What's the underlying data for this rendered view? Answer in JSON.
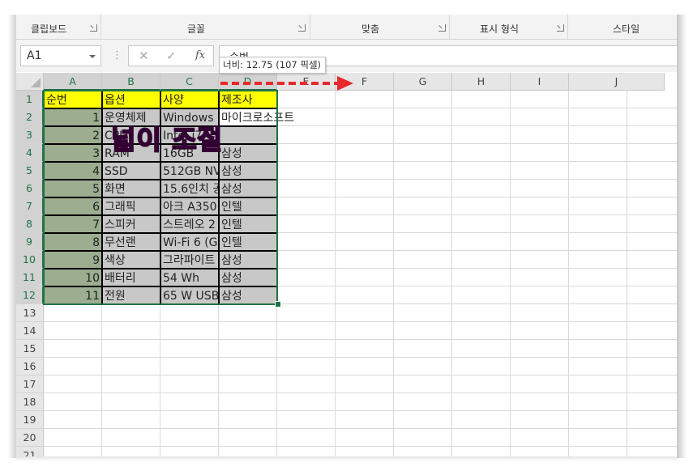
{
  "ribbon": {
    "groups": [
      {
        "label": "클립보드"
      },
      {
        "label": "글꼴"
      },
      {
        "label": "맞춤"
      },
      {
        "label": "표시 형식"
      },
      {
        "label": "스타일"
      }
    ]
  },
  "formula_bar": {
    "name_box": "A1",
    "formula": "순번",
    "fx_label": "fx"
  },
  "tooltip": "너비: 12.75 (107 픽셀)",
  "columns": [
    "A",
    "B",
    "C",
    "D",
    "E",
    "F",
    "G",
    "H",
    "I",
    "J"
  ],
  "rows": [
    "1",
    "2",
    "3",
    "4",
    "5",
    "6",
    "7",
    "8",
    "9",
    "10",
    "11",
    "12",
    "13",
    "14",
    "15",
    "16",
    "17",
    "18",
    "19",
    "20",
    "21"
  ],
  "table": {
    "headers": [
      "순번",
      "옵션",
      "사양",
      "제조사"
    ],
    "data": [
      [
        "1",
        "운영체제",
        "Windows",
        "마이크로소프트"
      ],
      [
        "2",
        "CPU",
        "Intel i7",
        ""
      ],
      [
        "3",
        "RAM",
        "16GB",
        "삼성"
      ],
      [
        "4",
        "SSD",
        "512GB NV",
        "삼성"
      ],
      [
        "5",
        "화면",
        "15.6인치 공",
        "삼성"
      ],
      [
        "6",
        "그래픽",
        "아크 A350",
        "인텔"
      ],
      [
        "7",
        "스피커",
        "스트레오 2",
        "인텔"
      ],
      [
        "8",
        "무선랜",
        "Wi-Fi 6 (G",
        "인텔"
      ],
      [
        "9",
        "색상",
        "그라파이트",
        "삼성"
      ],
      [
        "10",
        "배터리",
        "54 Wh",
        "삼성"
      ],
      [
        "11",
        "전원",
        "65 W USB",
        "삼성"
      ]
    ]
  },
  "overlay_text": "넓이 조절",
  "colors": {
    "header_fill": "#ffff00",
    "number_fill": "#9cad90",
    "body_fill": "#c8c8c8",
    "selection": "#217346",
    "annotation_text": "#ff18e8",
    "arrow": "#e8282b"
  }
}
